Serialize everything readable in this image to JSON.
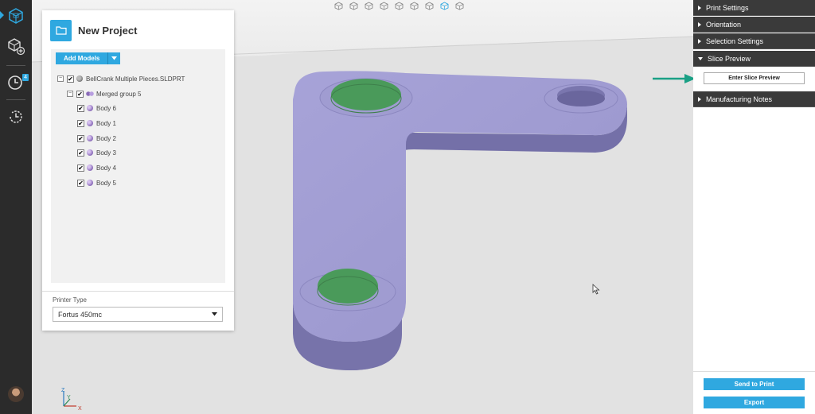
{
  "rail": {
    "items": [
      {
        "name": "build-prep-icon"
      },
      {
        "name": "add-part-icon"
      },
      {
        "name": "queue-icon",
        "badge": "4"
      },
      {
        "name": "history-icon"
      }
    ]
  },
  "view_toolbar": {
    "buttons": [
      "front-view-icon",
      "back-view-icon",
      "left-view-icon",
      "right-view-icon",
      "top-view-icon",
      "bottom-view-icon",
      "iso-view-icon",
      "fit-view-icon",
      "zoom-view-icon"
    ]
  },
  "project": {
    "title": "New Project",
    "add_models_label": "Add Models",
    "tree": {
      "root": {
        "label": "BellCrank Multiple Pieces.SLDPRT",
        "checked": true
      },
      "group": {
        "label": "Merged group 5",
        "checked": true
      },
      "bodies": [
        {
          "label": "Body 6",
          "checked": true
        },
        {
          "label": "Body 1",
          "checked": true
        },
        {
          "label": "Body 2",
          "checked": true
        },
        {
          "label": "Body 3",
          "checked": true
        },
        {
          "label": "Body 4",
          "checked": true
        },
        {
          "label": "Body 5",
          "checked": true
        }
      ]
    },
    "printer_type_label": "Printer Type",
    "printer_type_value": "Fortus 450mc"
  },
  "right_panel": {
    "sections": [
      {
        "label": "Print Settings",
        "expanded": false
      },
      {
        "label": "Orientation",
        "expanded": false
      },
      {
        "label": "Selection Settings",
        "expanded": false
      },
      {
        "label": "Slice Preview",
        "expanded": true
      },
      {
        "label": "Manufacturing Notes",
        "expanded": false
      }
    ],
    "enter_slice_label": "Enter Slice Preview",
    "send_to_print_label": "Send to Print",
    "export_label": "Export"
  },
  "axes": {
    "z": "Z",
    "y": "Y",
    "x": "X"
  },
  "colors": {
    "accent": "#2fa8e0",
    "part": "#9b97cc",
    "hole": "#4a9a5a",
    "arrow": "#1aa085",
    "panel_header": "#3a3a3a"
  }
}
